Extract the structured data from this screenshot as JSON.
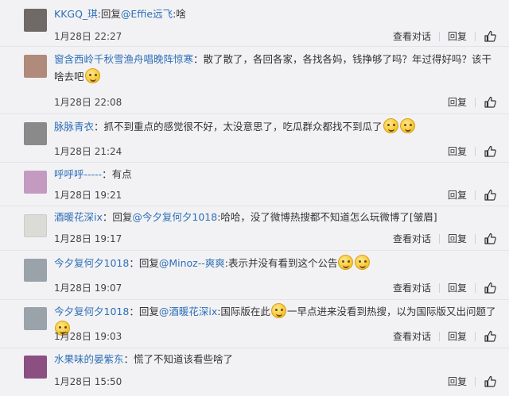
{
  "actions": {
    "view_thread": "查看对话",
    "reply": "回复"
  },
  "comments": [
    {
      "user": "KKGQ_琪",
      "prefix": ":",
      "reply_word": "回复",
      "mention": "@Effie远飞",
      "text": ":啥",
      "time": "1月28日 22:27",
      "has_thread": true,
      "avatar_color": "#6f6a66"
    },
    {
      "user": "窗含西岭千秋雪渔舟唱晚阵惊寒",
      "prefix": "：",
      "text_line1": "散了散了，各回各家，各找各妈，钱挣够了吗？年过得好吗？该干",
      "text_line2": "啥去吧",
      "time": "1月28日 22:08",
      "avatar_color": "#b08a7a"
    },
    {
      "user": "脉脉青衣",
      "prefix": "：",
      "text": "抓不到重点的感觉很不好，太没意思了，吃瓜群众都找不到瓜了",
      "time": "1月28日 21:24",
      "avatar_color": "#8a8a8a"
    },
    {
      "user": "呼呼呼-----",
      "prefix": "：",
      "text": "有点",
      "time": "1月28日 19:21",
      "avatar_color": "#c49ac0"
    },
    {
      "user": "酒暖花深ix",
      "prefix": "：",
      "reply_word": "回复",
      "mention": "@今夕复何夕1018",
      "text": ":哈哈，没了微博热搜都不知道怎么玩微博了[皱眉]",
      "time": "1月28日 19:17",
      "has_thread": true,
      "avatar_color": "#dcdcd6"
    },
    {
      "user": "今夕复何夕1018",
      "prefix": "：",
      "reply_word": "回复",
      "mention": "@Minoz--爽爽",
      "text": ":表示并没有看到这个公告",
      "time": "1月28日 19:07",
      "has_thread": true,
      "avatar_color": "#9aa2aa"
    },
    {
      "user": "今夕复何夕1018",
      "prefix": "：",
      "reply_word": "回复",
      "mention": "@酒暖花深ix",
      "text_a": ":国际版在此",
      "text_b": "一早点进来没看到热搜，以为国际版又出问题了",
      "time": "1月28日 19:03",
      "has_thread": true,
      "avatar_color": "#9aa2aa"
    },
    {
      "user": "水果味的晏紫东",
      "prefix": "：",
      "text": "慌了不知道该看些啥了",
      "time": "1月28日 15:50",
      "avatar_color": "#8b4f82"
    }
  ]
}
